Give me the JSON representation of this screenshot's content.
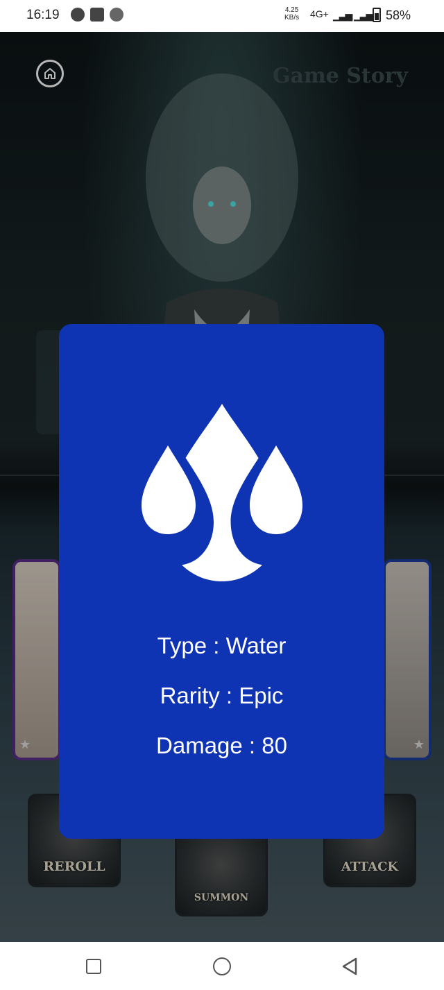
{
  "status_bar": {
    "time": "16:19",
    "net_speed_value": "4.25",
    "net_speed_unit": "KB/s",
    "network_type": "4G+",
    "battery_percent": "58%"
  },
  "header": {
    "title": "Game Story",
    "home_icon": "home-icon"
  },
  "actions": {
    "reroll_label": "REROLL",
    "summon_label": "SUMMON",
    "attack_label": "ATTACK"
  },
  "card_modal": {
    "element_icon": "water-drops-icon",
    "type_text": "Type : Water",
    "rarity_text": "Rarity : Epic",
    "damage_text": "Damage : 80",
    "background_color": "#0f34b3"
  },
  "nav_bar": {
    "recents_icon": "square-icon",
    "home_icon": "circle-icon",
    "back_icon": "triangle-back-icon"
  }
}
